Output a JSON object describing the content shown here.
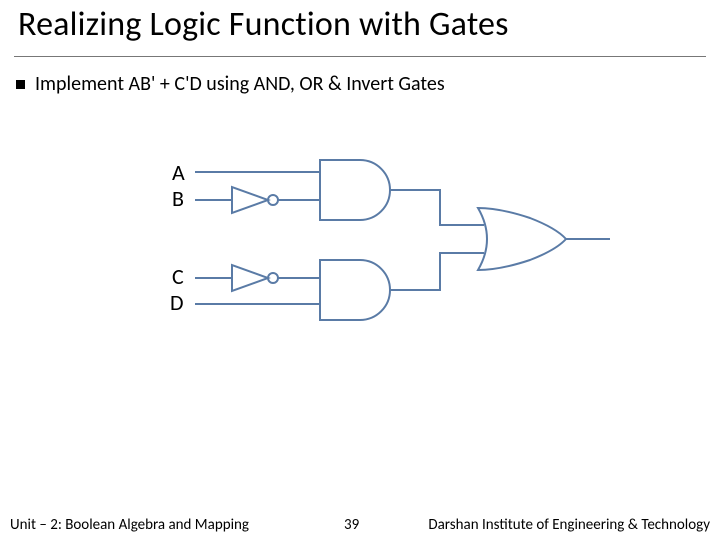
{
  "title": "Realizing Logic Function with Gates",
  "bullet": "Implement AB' + C'D using AND, OR & Invert Gates",
  "signals": {
    "a": "A",
    "b": "B",
    "c": "C",
    "d": "D"
  },
  "footer": {
    "unit": "Unit – 2: Boolean Algebra and Mapping",
    "page": "39",
    "institute": "Darshan Institute of Engineering & Technology"
  },
  "diagram": {
    "description": "Two input pairs (A, B') and (C', D) each feed an AND gate; the two AND outputs feed an OR gate. B and C are inverted before the AND gates.",
    "gates": [
      {
        "id": "inv1",
        "type": "NOT",
        "inputs": [
          "B"
        ],
        "output": "B'"
      },
      {
        "id": "inv2",
        "type": "NOT",
        "inputs": [
          "C"
        ],
        "output": "C'"
      },
      {
        "id": "and1",
        "type": "AND",
        "inputs": [
          "A",
          "B'"
        ],
        "output": "AB'"
      },
      {
        "id": "and2",
        "type": "AND",
        "inputs": [
          "C'",
          "D"
        ],
        "output": "C'D"
      },
      {
        "id": "or1",
        "type": "OR",
        "inputs": [
          "AB'",
          "C'D"
        ],
        "output": "AB' + C'D"
      }
    ],
    "stroke": "#5a7ba6"
  }
}
